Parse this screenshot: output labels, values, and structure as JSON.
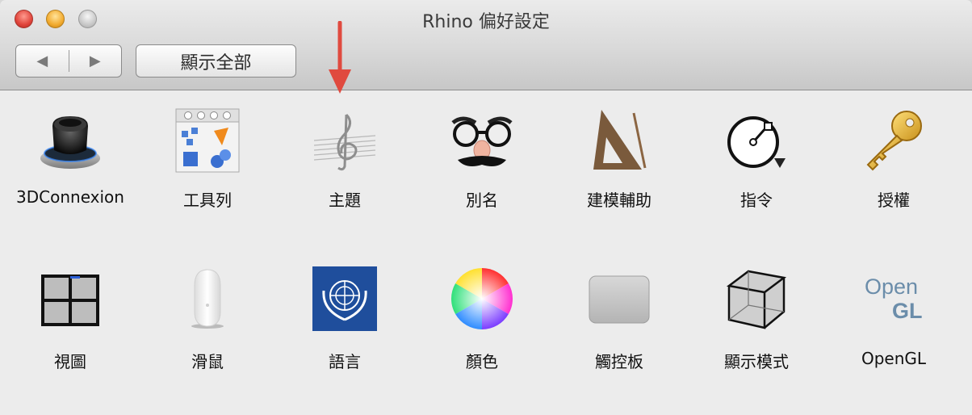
{
  "window": {
    "title": "Rhino 偏好設定"
  },
  "toolbar": {
    "back": "◀",
    "forward": "▶",
    "show_all": "顯示全部"
  },
  "annotation": {
    "arrow_color": "#e04a3f"
  },
  "row1": [
    {
      "label": "3DConnexion",
      "icon": "3d-mouse-icon"
    },
    {
      "label": "工具列",
      "icon": "toolbar-icon"
    },
    {
      "label": "主題",
      "icon": "music-clef-icon"
    },
    {
      "label": "別名",
      "icon": "groucho-glasses-icon"
    },
    {
      "label": "建模輔助",
      "icon": "triangle-ruler-icon"
    },
    {
      "label": "指令",
      "icon": "circle-command-icon"
    },
    {
      "label": "授權",
      "icon": "key-icon"
    }
  ],
  "row2": [
    {
      "label": "視圖",
      "icon": "viewport-grid-icon"
    },
    {
      "label": "滑鼠",
      "icon": "mouse-icon"
    },
    {
      "label": "語言",
      "icon": "un-emblem-icon"
    },
    {
      "label": "顏色",
      "icon": "color-wheel-icon"
    },
    {
      "label": "觸控板",
      "icon": "trackpad-icon"
    },
    {
      "label": "顯示模式",
      "icon": "wireframe-cube-icon"
    },
    {
      "label": "OpenGL",
      "icon": "opengl-logo-icon"
    }
  ],
  "opengl_logo": {
    "line1": "Open",
    "line2": "GL"
  }
}
